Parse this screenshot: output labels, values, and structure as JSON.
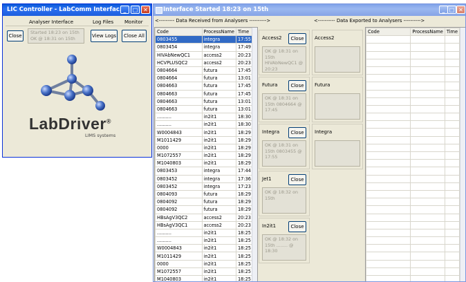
{
  "controller": {
    "title": "LIC Controller - LabComm Interfac...",
    "group_analyser": "Analyser Interface",
    "group_logs": "Log Files",
    "group_monitor": "Monitor",
    "close_label": "Close",
    "status_line1": "Started 18:23 on 15th",
    "status_line2": "OK @ 18:31 on 15th",
    "view_logs_label": "View Logs",
    "close_all_label": "Close All",
    "logo_text": "LabDriver",
    "logo_reg": "®",
    "logo_sub": "LIMS systems"
  },
  "interface": {
    "title": "Interface Started 18:23 on 15th",
    "received_header": "<--------- Data Received from Analysers ---------->",
    "exported_header": "<---------- Data Exported to Analysers ---------->",
    "columns": [
      "Code",
      "ProcessName",
      "Time"
    ],
    "export_columns": [
      "Code",
      "ProcessName",
      "Time"
    ],
    "rows": [
      [
        "0803455",
        "integra",
        "17:55"
      ],
      [
        "0803454",
        "integra",
        "17:49"
      ],
      [
        "HIVAbNewQC1",
        "access2",
        "20:23"
      ],
      [
        "HCVPLUSQC2",
        "access2",
        "20:23"
      ],
      [
        "0804664",
        "futura",
        "17:45"
      ],
      [
        "0804664",
        "futura",
        "13:01"
      ],
      [
        "0804663",
        "futura",
        "17:45"
      ],
      [
        "0804663",
        "futura",
        "17:45"
      ],
      [
        "0804663",
        "futura",
        "13:01"
      ],
      [
        "0804663",
        "futura",
        "13:01"
      ],
      [
        "..........",
        "in2it1",
        "18:30"
      ],
      [
        "..........",
        "in2it1",
        "18:30"
      ],
      [
        "W0004843",
        "in2it1",
        "18:29"
      ],
      [
        "M1011429",
        "in2it1",
        "18:29"
      ],
      [
        "0000",
        "in2it1",
        "18:29"
      ],
      [
        "M1072557",
        "in2it1",
        "18:29"
      ],
      [
        "M1040803",
        "in2it1",
        "18:29"
      ],
      [
        "0803453",
        "integra",
        "17:44"
      ],
      [
        "0803452",
        "integra",
        "17:36"
      ],
      [
        "0803452",
        "integra",
        "17:23"
      ],
      [
        "0804093",
        "futura",
        "18:29"
      ],
      [
        "0804092",
        "futura",
        "18:29"
      ],
      [
        "0804092",
        "futura",
        "18:29"
      ],
      [
        "HBsAgV3QC2",
        "access2",
        "20:23"
      ],
      [
        "HBsAgV3QC1",
        "access2",
        "20:23"
      ],
      [
        "..........",
        "in2it1",
        "18:25"
      ],
      [
        "..........",
        "in2it1",
        "18:25"
      ],
      [
        "W0004843",
        "in2it1",
        "18:25"
      ],
      [
        "M1011429",
        "in2it1",
        "18:25"
      ],
      [
        "0000",
        "in2it1",
        "18:25"
      ],
      [
        "M1072557",
        "in2it1",
        "18:25"
      ],
      [
        "M1040803",
        "in2it1",
        "18:25"
      ]
    ],
    "analysers": [
      {
        "name": "Access2",
        "close": "Close",
        "status": "OK @ 18:31 on 15th  HIVAbNewQC1 @ 20:23",
        "export_name": "Access2"
      },
      {
        "name": "Futura",
        "close": "Close",
        "status": "OK @ 18:31 on 15th  0804664 @ 17:45",
        "export_name": "Futura"
      },
      {
        "name": "Integra",
        "close": "Close",
        "status": "OK @ 18:31 on 15th  0803455 @ 17:55",
        "export_name": "Integra"
      },
      {
        "name": "Jet1",
        "close": "Close",
        "status": "OK @ 18:32 on 15th",
        "export_name": ""
      },
      {
        "name": "In2it1",
        "close": "Close",
        "status": "OK @ 18:32 on 15th  ........ @ 18:30",
        "export_name": ""
      }
    ]
  },
  "colors": {
    "title_blue": "#0a5ad8",
    "selection": "#316ac5",
    "logo_blue": "#4a73c8"
  }
}
